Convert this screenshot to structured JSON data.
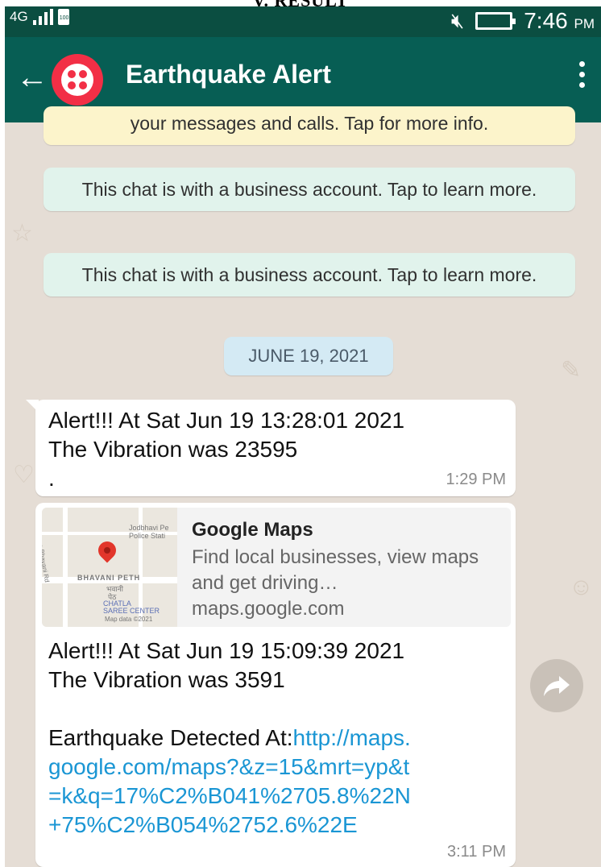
{
  "caption": "V. RESULT",
  "status": {
    "network": "4G",
    "battery_small": "100",
    "time": "7:46",
    "ampm": "PM"
  },
  "header": {
    "title": "Earthquake Alert"
  },
  "chat": {
    "encryption_notice": "your messages and calls. Tap for more info.",
    "business_notice_1": "This chat is with a business account. Tap to learn more.",
    "business_notice_2": "This chat is with a business account. Tap to learn more.",
    "date_chip": "JUNE 19, 2021",
    "messages": [
      {
        "text": "Alert!!! At Sat Jun 19 13:28:01 2021\nThe Vibration was 23595\n.",
        "time": "1:29 PM"
      },
      {
        "preview": {
          "title": "Google Maps",
          "description": "Find local businesses, view maps and get driving…",
          "domain": "maps.google.com",
          "map_labels": [
            "Jodbhavi Pe",
            "Police Stati",
            "BHAVANI PETH",
            "भवानी",
            "पेठ",
            "CHATLA",
            "SAREE CENTER",
            "Map data ©2021",
            "Rupa Bhavani Rd"
          ]
        },
        "text_line1": "Alert!!! At Sat Jun 19 15:09:39 2021",
        "text_line2": "The Vibration was 3591",
        "text_prefix": "Earthquake Detected At:",
        "link": "http://maps.google.com/maps?&z=15&mrt=yp&t=k&q=17%C2%B041%2705.8%22N+75%C2%B054%2752.6%22E",
        "time": "3:11 PM"
      }
    ]
  }
}
